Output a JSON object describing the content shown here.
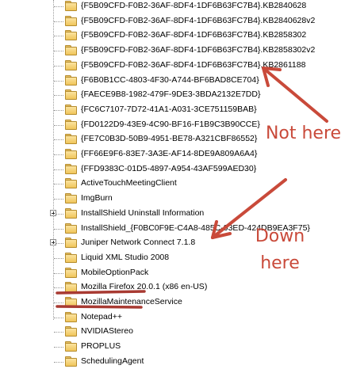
{
  "tree": {
    "items": [
      {
        "label": "{F5B09CFD-F0B2-36AF-8DF4-1DF6B63FC7B4}.KB2840628",
        "expandable": false
      },
      {
        "label": "{F5B09CFD-F0B2-36AF-8DF4-1DF6B63FC7B4}.KB2840628v2",
        "expandable": false
      },
      {
        "label": "{F5B09CFD-F0B2-36AF-8DF4-1DF6B63FC7B4}.KB2858302",
        "expandable": false
      },
      {
        "label": "{F5B09CFD-F0B2-36AF-8DF4-1DF6B63FC7B4}.KB2858302v2",
        "expandable": false
      },
      {
        "label": "{F5B09CFD-F0B2-36AF-8DF4-1DF6B63FC7B4}.KB2861188",
        "expandable": false
      },
      {
        "label": "{F6B0B1CC-4803-4F30-A744-BF6BAD8CE704}",
        "expandable": false
      },
      {
        "label": "{FAECE9B8-1982-479F-9DE3-3BDA2132E7DD}",
        "expandable": false
      },
      {
        "label": "{FC6C7107-7D72-41A1-A031-3CE751159BAB}",
        "expandable": false
      },
      {
        "label": "{FD0122D9-43E9-4C90-BF16-F1B9C3B90CCE}",
        "expandable": false
      },
      {
        "label": "{FE7C0B3D-50B9-4951-BE78-A321CBF86552}",
        "expandable": false
      },
      {
        "label": "{FF66E9F6-83E7-3A3E-AF14-8DE9A809A6A4}",
        "expandable": false
      },
      {
        "label": "{FFD9383C-01D5-4897-A954-43AF599AED30}",
        "expandable": false
      },
      {
        "label": "ActiveTouchMeetingClient",
        "expandable": false
      },
      {
        "label": "ImgBurn",
        "expandable": false
      },
      {
        "label": "InstallShield Uninstall Information",
        "expandable": true
      },
      {
        "label": "InstallShield_{F0BC0F9E-C4A8-485C-93ED-424DB9EA3F75}",
        "expandable": false
      },
      {
        "label": "Juniper Network Connect 7.1.8",
        "expandable": true
      },
      {
        "label": "Liquid XML Studio 2008",
        "expandable": false
      },
      {
        "label": "MobileOptionPack",
        "expandable": false
      },
      {
        "label": "Mozilla Firefox 20.0.1 (x86 en-US)",
        "expandable": false
      },
      {
        "label": "MozillaMaintenanceService",
        "expandable": false
      },
      {
        "label": "Notepad++",
        "expandable": false
      },
      {
        "label": "NVIDIAStereo",
        "expandable": false
      },
      {
        "label": "PROPLUS",
        "expandable": false
      },
      {
        "label": "SchedulingAgent",
        "expandable": false
      }
    ]
  },
  "annotations": {
    "not_here": "Not here",
    "down": "Down",
    "here": "here",
    "color": "#c94a3a"
  }
}
